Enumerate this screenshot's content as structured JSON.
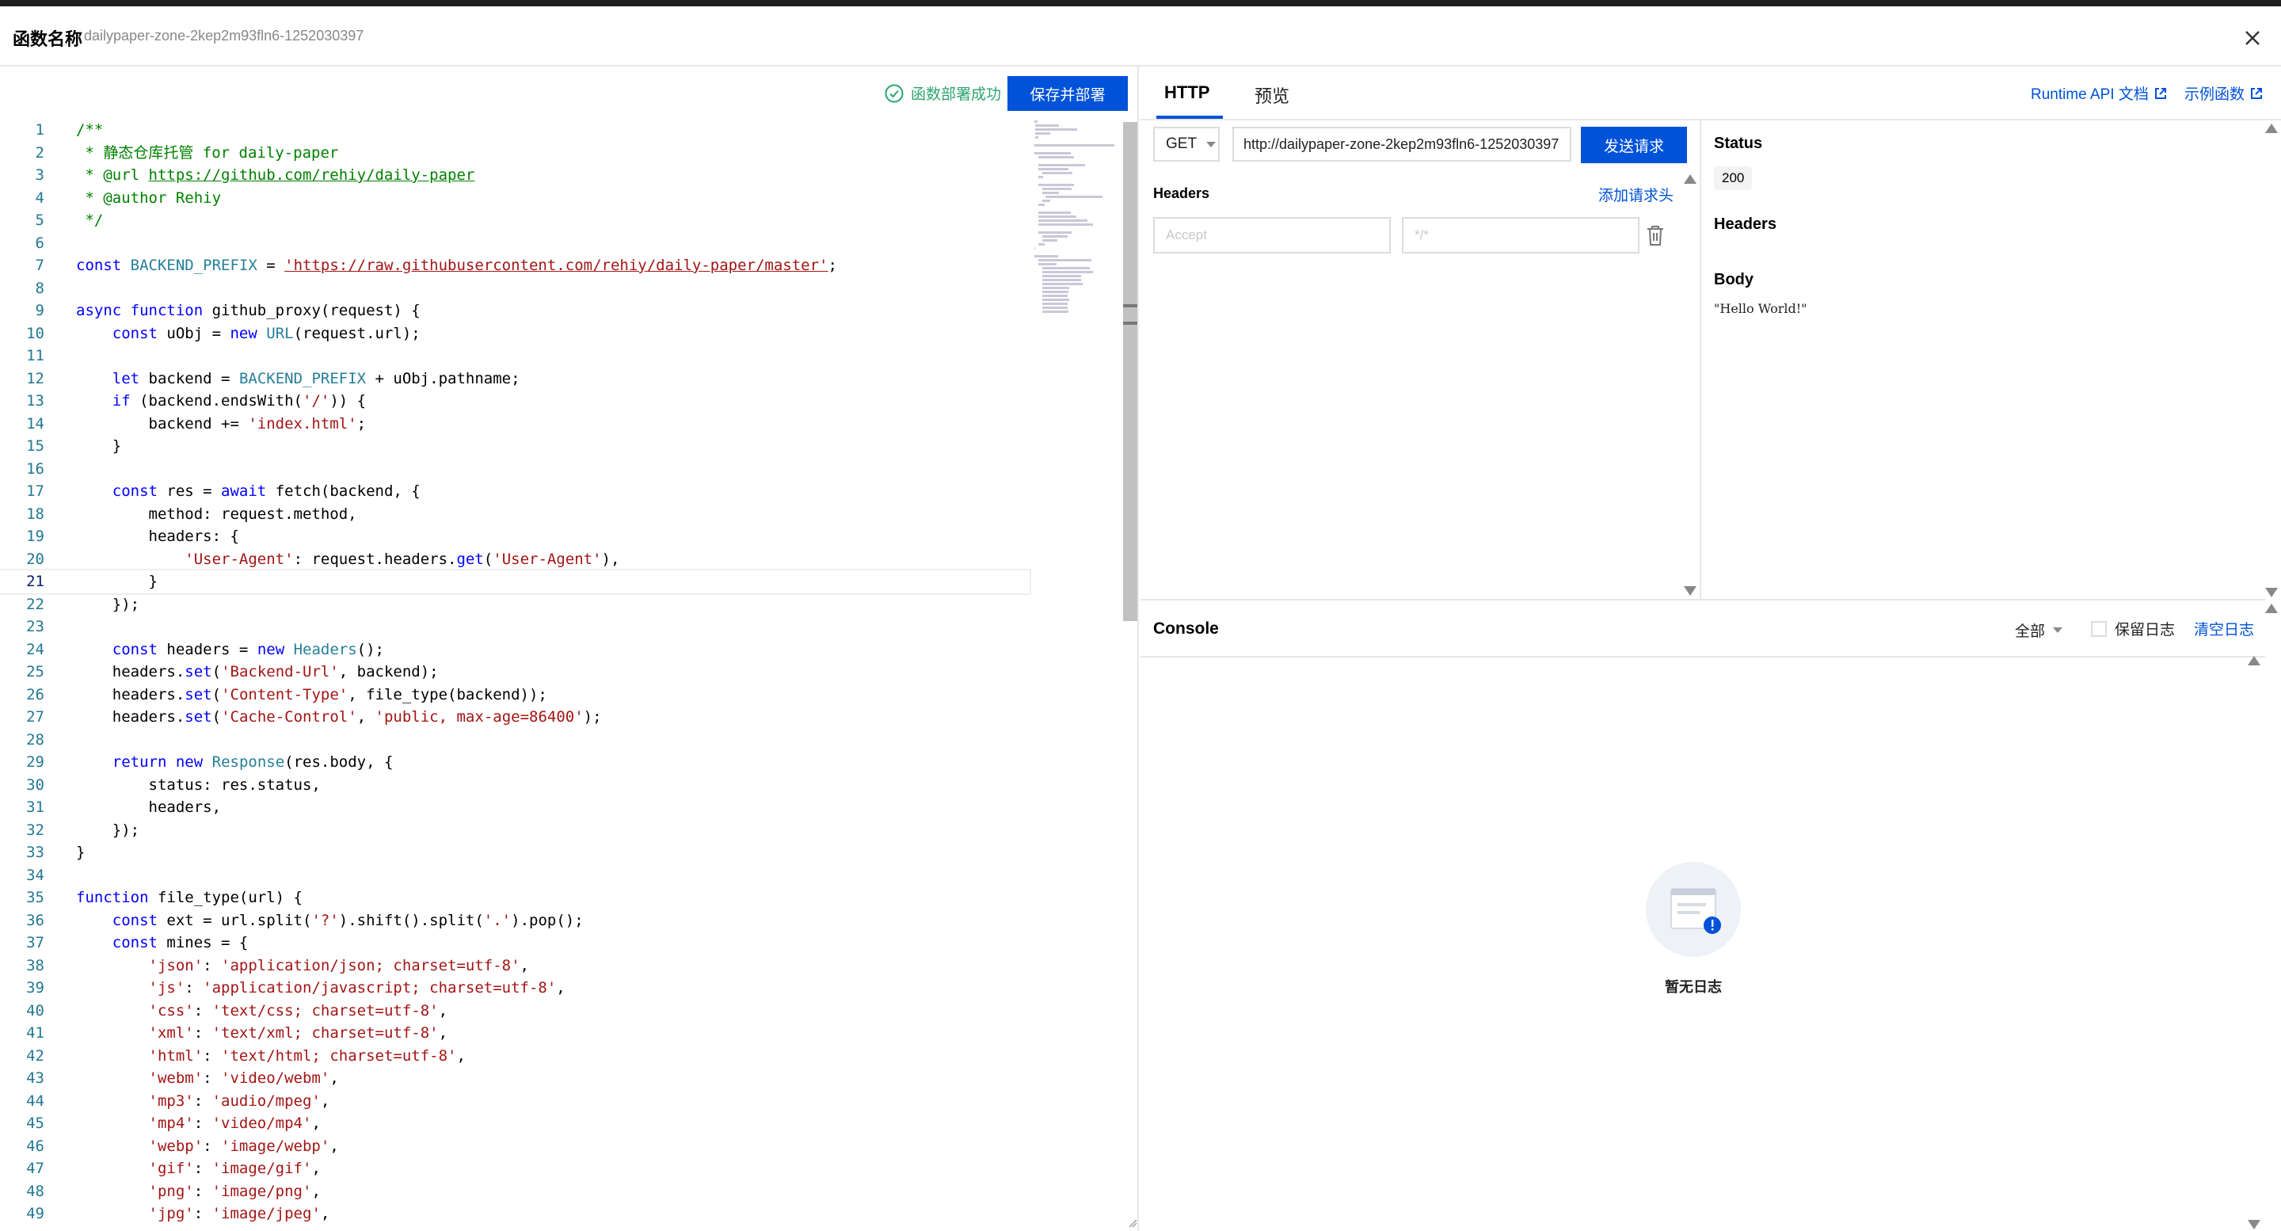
{
  "header": {
    "title": "函数名称",
    "function_id": "dailypaper-zone-2kep2m93fln6-1252030397"
  },
  "editor_toolbar": {
    "deploy_status": "函数部署成功",
    "save_deploy_label": "保存并部署"
  },
  "editor": {
    "active_line": 21,
    "lines": [
      "/**",
      " * 静态仓库托管 for daily-paper",
      " * @url https://github.com/rehiy/daily-paper",
      " * @author Rehiy",
      " */",
      "",
      "const BACKEND_PREFIX = 'https://raw.githubusercontent.com/rehiy/daily-paper/master';",
      "",
      "async function github_proxy(request) {",
      "    const uObj = new URL(request.url);",
      "",
      "    let backend = BACKEND_PREFIX + uObj.pathname;",
      "    if (backend.endsWith('/')) {",
      "        backend += 'index.html';",
      "    }",
      "",
      "    const res = await fetch(backend, {",
      "        method: request.method,",
      "        headers: {",
      "            'User-Agent': request.headers.get('User-Agent'),",
      "        }",
      "    });",
      "",
      "    const headers = new Headers();",
      "    headers.set('Backend-Url', backend);",
      "    headers.set('Content-Type', file_type(backend));",
      "    headers.set('Cache-Control', 'public, max-age=86400');",
      "",
      "    return new Response(res.body, {",
      "        status: res.status,",
      "        headers,",
      "    });",
      "}",
      "",
      "function file_type(url) {",
      "    const ext = url.split('?').shift().split('.').pop();",
      "    const mines = {",
      "        'json': 'application/json; charset=utf-8',",
      "        'js': 'application/javascript; charset=utf-8',",
      "        'css': 'text/css; charset=utf-8',",
      "        'xml': 'text/xml; charset=utf-8',",
      "        'html': 'text/html; charset=utf-8',",
      "        'webm': 'video/webm',",
      "        'mp3': 'audio/mpeg',",
      "        'mp4': 'video/mp4',",
      "        'webp': 'image/webp',",
      "        'gif': 'image/gif',",
      "        'png': 'image/png',",
      "        'jpg': 'image/jpeg',"
    ]
  },
  "http_panel": {
    "tabs": [
      {
        "label": "HTTP",
        "active": true
      },
      {
        "label": "预览",
        "active": false
      }
    ],
    "runtime_api_doc": "Runtime API 文档",
    "example_functions": "示例函数",
    "method": "GET",
    "url": "http://dailypaper-zone-2kep2m93fln6-1252030397",
    "send_label": "发送请求",
    "headers_label": "Headers",
    "add_header_label": "添加请求头",
    "header_key_placeholder": "Accept",
    "header_value_placeholder": "*/*"
  },
  "response": {
    "status_label": "Status",
    "status_code": "200",
    "headers_label": "Headers",
    "body_label": "Body",
    "body_value": "\"Hello World!\""
  },
  "console": {
    "title": "Console",
    "filter": "全部",
    "keep_log_label": "保留日志",
    "clear_log_label": "清空日志",
    "empty_text": "暂无日志"
  },
  "colors": {
    "primary": "#0052d9",
    "success": "#2ba471",
    "comment": "#008000",
    "keyword": "#0000ff",
    "string": "#a31515",
    "type": "#267f99",
    "line_number": "#237893"
  }
}
